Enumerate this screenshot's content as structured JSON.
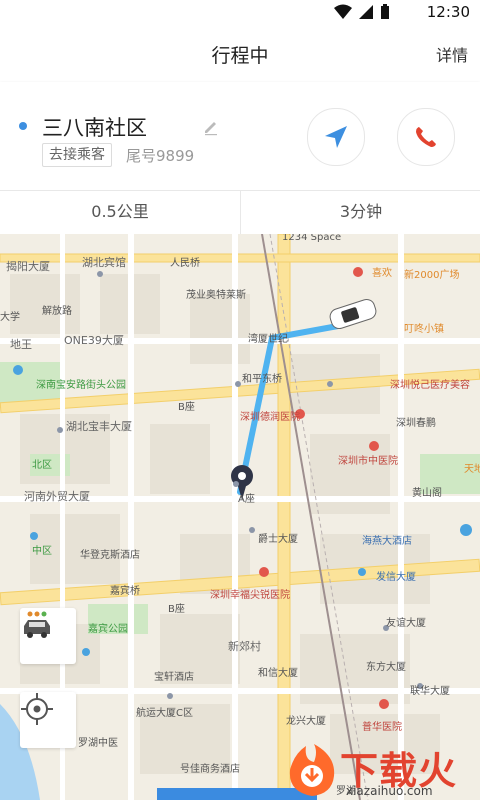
{
  "status": {
    "time": "12:30"
  },
  "header": {
    "title": "行程中",
    "detail": "详情"
  },
  "card": {
    "place": "三八南社区",
    "status_tag": "去接乘客",
    "tail_number": "尾号9899",
    "distance": "0.5公里",
    "duration": "3分钟"
  },
  "map": {
    "labels": [
      "揭阳大厦",
      "湖北宾馆",
      "人民桥",
      "1234 Space",
      "喜欢",
      "新2000广场",
      "大学",
      "解放路",
      "茂业奥特莱斯",
      "地王",
      "ONE39大厦",
      "湾厦世纪",
      "叮咚小镇",
      "深南宝安路街头公园",
      "和平东桥",
      "B座",
      "深圳悦己医疗美容",
      "湖北宝丰大厦",
      "深圳德润医院",
      "深圳春鹏",
      "北区",
      "深圳市中医院",
      "河南外贸大厦",
      "A座",
      "黄山阁",
      "爵士大厦",
      "海燕大酒店",
      "天地",
      "中区",
      "华登克斯酒店",
      "嘉宾桥",
      "B座",
      "发信大厦",
      "深圳幸福尖锐医院",
      "嘉宾公园",
      "新郊村",
      "友谊大厦",
      "宝轩酒店",
      "和信大厦",
      "东方大厦",
      "联华大厦",
      "航运大厦C区",
      "龙兴大厦",
      "普华医院",
      "罗湖中医",
      "号佳商务酒店",
      "罗湖"
    ]
  },
  "watermark": {
    "zh": "下载火",
    "en": "xiazaihuo.com"
  }
}
